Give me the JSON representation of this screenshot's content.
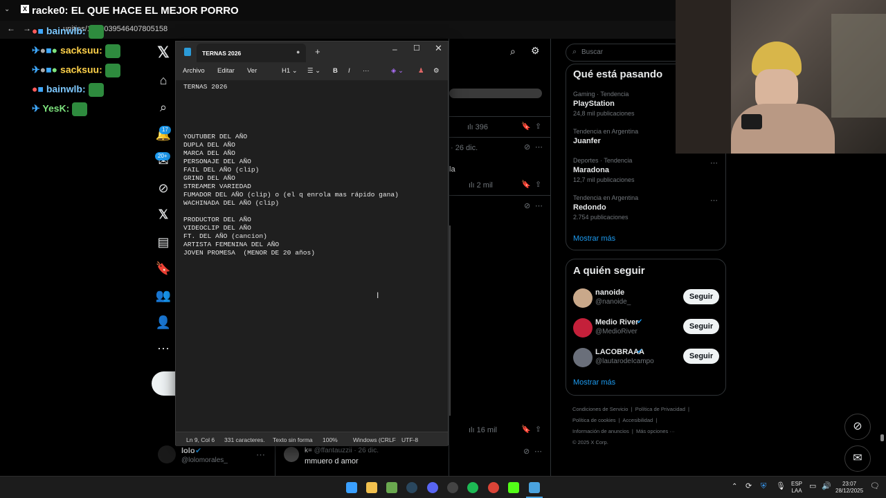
{
  "browser": {
    "tab_title": "racke0: EL QUE HACE EL MEJOR PORRO",
    "address": "…unities/1851039546407805158"
  },
  "chat": [
    {
      "user": "bainwlb:",
      "msg": ""
    },
    {
      "user": "sacksuu:",
      "msg": ""
    },
    {
      "user": "sacksuu:",
      "msg": ""
    },
    {
      "user": "bainwlb:",
      "msg": ""
    },
    {
      "user": "YesK:",
      "msg": ""
    }
  ],
  "x_nav": {
    "notif_badge": "17",
    "msg_badge": "20+"
  },
  "feed": {
    "views_1": "396",
    "date_1": "26 dic.",
    "text_1": "la",
    "views_2": "2 mil",
    "views_3": "16 mil",
    "post_user": "lolo",
    "post_handle": "@lolomorales_",
    "post2_user": "k=",
    "post2_handle": "@ffantauzzii · 26 dic.",
    "post2_text": "mmuero d amor"
  },
  "sidebar": {
    "search_placeholder": "Buscar",
    "trending_title": "Qué está pasando",
    "trends": [
      {
        "meta": "Gaming · Tendencia",
        "name": "PlayStation",
        "count": "24,8 mil publicaciones"
      },
      {
        "meta": "Tendencia en Argentina",
        "name": "Juanfer",
        "count": ""
      },
      {
        "meta": "Deportes · Tendencia",
        "name": "Maradona",
        "count": "12,7 mil publicaciones"
      },
      {
        "meta": "Tendencia en Argentina",
        "name": "Redondo",
        "count": "2.754 publicaciones"
      }
    ],
    "trends_more": "Mostrar más",
    "follow_title": "A quién seguir",
    "follow": [
      {
        "name": "nanoide",
        "handle": "@nanoide_",
        "button": "Seguir"
      },
      {
        "name": "Medio River",
        "handle": "@MedioRiver",
        "button": "Seguir"
      },
      {
        "name": "LACOBRAAA",
        "handle": "@lautarodeIcampo",
        "button": "Seguir"
      }
    ],
    "follow_more": "Mostrar más",
    "footer": [
      "Condiciones de Servicio",
      "Política de Privacidad",
      "Política de cookies",
      "Accesibilidad",
      "Información de anuncios",
      "Más opciones ···",
      "© 2025 X Corp."
    ]
  },
  "notepad": {
    "tab_title": "TERNAS 2026",
    "menu": [
      "Archivo",
      "Editar",
      "Ver"
    ],
    "heading_btn": "H1",
    "content": "TERNAS 2026\n\n\n\n\n\nYOUTUBER DEL AÑO\nDUPLA DEL AÑO\nMARCA DEL AÑO\nPERSONAJE DEL AÑO\nFAIL DEL AÑO (clip)\nGRIND DEL AÑO\nSTREAMER VARIEDAD\nFUMADOR DEL AÑO (clip) o (el q enrola mas rápido gana)\nWACHINADA DEL AÑO (clip)\n\nPRODUCTOR DEL AÑO\nVIDEOCLIP DEL AÑO\nFT. DEL AÑO (cancion)\nARTISTA FEMENINA DEL AÑO\nJOVEN PROMESA  (MENOR DE 20 años)",
    "status": {
      "position": "Ln 9, Col 6",
      "chars": "331 caracteres.",
      "format": "Texto sin forma",
      "zoom": "100%",
      "eol": "Windows (CRLF",
      "encoding": "UTF-8"
    }
  },
  "taskbar": {
    "lang": "ESP",
    "lang2": "LAA",
    "time": "23:07",
    "date": "28/12/2025"
  },
  "colors": {
    "accent": "#1d9bf0",
    "bg": "#000000",
    "notepad_bg": "#1f1f1f"
  }
}
